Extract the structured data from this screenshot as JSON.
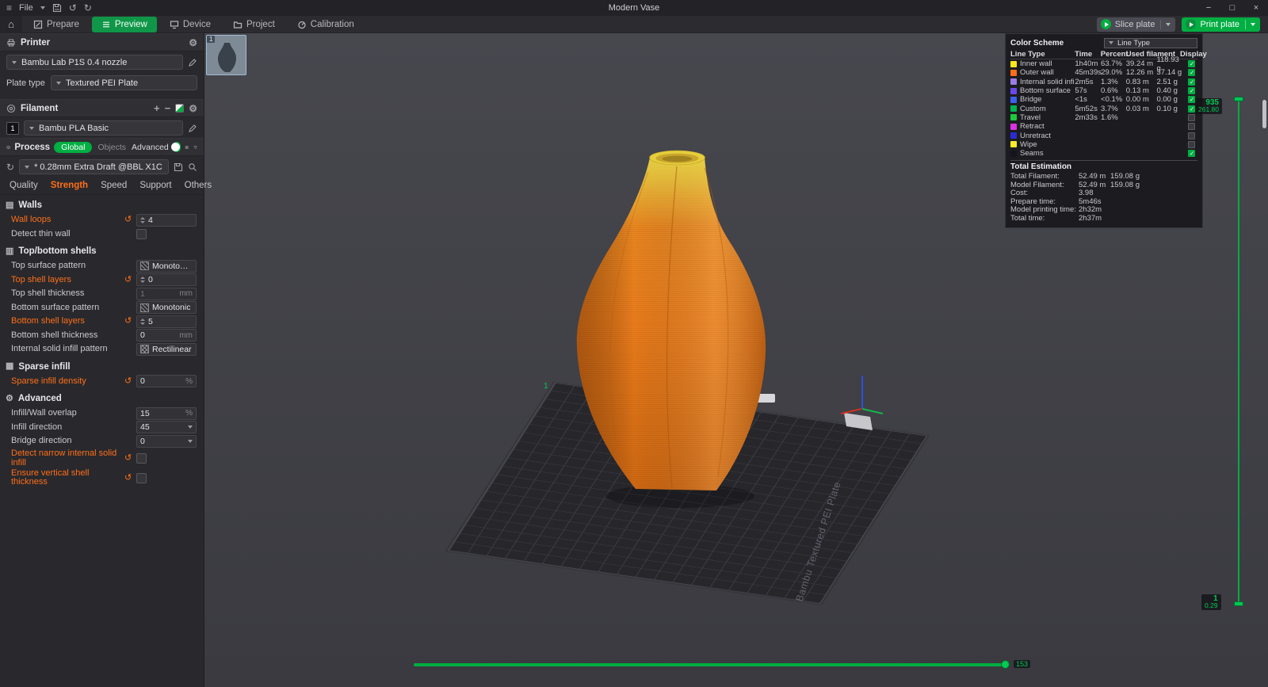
{
  "colors": {
    "accent": "#00AE42",
    "modified": "#FF6E19"
  },
  "icons": {
    "menu": "≡",
    "home": "⌂",
    "gear": "⚙",
    "plus": "+",
    "minus": "−",
    "undo": "↺",
    "redo": "↻",
    "sync": "↻",
    "reset": "↺",
    "minimize": "−",
    "maximize": "□",
    "close": "×"
  },
  "titlebar": {
    "file_label": "File",
    "title": "Modern Vase"
  },
  "tabbar": {
    "tabs": [
      "Prepare",
      "Preview",
      "Device",
      "Project",
      "Calibration"
    ],
    "active_tab": "Preview",
    "slice_label": "Slice plate",
    "print_label": "Print plate"
  },
  "printer": {
    "header": "Printer",
    "preset": "Bambu Lab P1S 0.4 nozzle",
    "plate_type_label": "Plate type",
    "plate_type_value": "Textured PEI Plate"
  },
  "filament": {
    "header": "Filament",
    "slot": "1",
    "preset": "Bambu PLA Basic"
  },
  "process": {
    "header": "Process",
    "scope_global": "Global",
    "scope_objects": "Objects",
    "advanced_label": "Advanced",
    "preset": "* 0.28mm Extra Draft @BBL X1C",
    "tabs": [
      "Quality",
      "Strength",
      "Speed",
      "Support",
      "Others"
    ],
    "active_tab": "Strength"
  },
  "params": {
    "walls_header": "Walls",
    "wall_loops": {
      "label": "Wall loops",
      "value": "4"
    },
    "detect_thin_wall": {
      "label": "Detect thin wall"
    },
    "shells_header": "Top/bottom shells",
    "top_surface_pattern": {
      "label": "Top surface pattern",
      "value": "Monotonic li..."
    },
    "top_shell_layers": {
      "label": "Top shell layers",
      "value": "0"
    },
    "top_shell_thickness": {
      "label": "Top shell thickness",
      "value": "1",
      "unit": "mm"
    },
    "bottom_surface_pattern": {
      "label": "Bottom surface pattern",
      "value": "Monotonic"
    },
    "bottom_shell_layers": {
      "label": "Bottom shell layers",
      "value": "5"
    },
    "bottom_shell_thickness": {
      "label": "Bottom shell thickness",
      "value": "0",
      "unit": "mm"
    },
    "internal_solid_infill_pattern": {
      "label": "Internal solid infill pattern",
      "value": "Rectilinear"
    },
    "sparse_header": "Sparse infill",
    "sparse_infill_density": {
      "label": "Sparse infill density",
      "value": "0",
      "unit": "%"
    },
    "advanced_header": "Advanced",
    "infill_wall_overlap": {
      "label": "Infill/Wall overlap",
      "value": "15",
      "unit": "%"
    },
    "infill_direction": {
      "label": "Infill direction",
      "value": "45"
    },
    "bridge_direction": {
      "label": "Bridge direction",
      "value": "0"
    },
    "detect_narrow_infill": {
      "label": "Detect narrow internal solid infill"
    },
    "ensure_vertical_thickness": {
      "label": "Ensure vertical shell thickness"
    }
  },
  "legend": {
    "title": "Color Scheme",
    "view_type": "Line Type",
    "col_line_type": "Line Type",
    "col_time": "Time",
    "col_percent": "Percent",
    "col_used_filament": "Used filament",
    "col_display": "Display",
    "rows": [
      {
        "name": "Inner wall",
        "color": "#FFE61A",
        "time": "1h40m",
        "percent": "63.7%",
        "len": "39.24 m",
        "weight": "118.93 g",
        "checked": true
      },
      {
        "name": "Outer wall",
        "color": "#FF6E19",
        "time": "45m39s",
        "percent": "29.0%",
        "len": "12.26 m",
        "weight": "37.14 g",
        "checked": true
      },
      {
        "name": "Internal solid infill",
        "color": "#9B7DE8",
        "time": "2m5s",
        "percent": "1.3%",
        "len": "0.83 m",
        "weight": "2.51 g",
        "checked": true
      },
      {
        "name": "Bottom surface",
        "color": "#6B49E8",
        "time": "57s",
        "percent": "0.6%",
        "len": "0.13 m",
        "weight": "0.40 g",
        "checked": true
      },
      {
        "name": "Bridge",
        "color": "#3C60EE",
        "time": "<1s",
        "percent": "<0.1%",
        "len": "0.00 m",
        "weight": "0.00 g",
        "checked": true
      },
      {
        "name": "Custom",
        "color": "#00B450",
        "time": "5m52s",
        "percent": "3.7%",
        "len": "0.03 m",
        "weight": "0.10 g",
        "checked": true
      },
      {
        "name": "Travel",
        "color": "#1EC93C",
        "time": "2m33s",
        "percent": "1.6%",
        "len": "",
        "weight": "",
        "checked": false
      },
      {
        "name": "Retract",
        "color": "#D933DF",
        "time": "",
        "percent": "",
        "len": "",
        "weight": "",
        "checked": false
      },
      {
        "name": "Unretract",
        "color": "#2B2BD5",
        "time": "",
        "percent": "",
        "len": "",
        "weight": "",
        "checked": false
      },
      {
        "name": "Wipe",
        "color": "#FFEC28",
        "time": "",
        "percent": "",
        "len": "",
        "weight": "",
        "checked": false
      },
      {
        "name": "Seams",
        "color": "#14141E",
        "time": "",
        "percent": "",
        "len": "",
        "weight": "",
        "checked": true
      }
    ],
    "total_header": "Total Estimation",
    "totals": [
      {
        "label": "Total Filament:",
        "v1": "52.49 m",
        "v2": "159.08 g"
      },
      {
        "label": "Model Filament:",
        "v1": "52.49 m",
        "v2": "159.08 g"
      },
      {
        "label": "Cost:",
        "v1": "3.98",
        "v2": ""
      },
      {
        "label": "Prepare time:",
        "v1": "5m46s",
        "v2": ""
      },
      {
        "label": "Model printing time:",
        "v1": "2h32m",
        "v2": ""
      },
      {
        "label": "Total time:",
        "v1": "2h37m",
        "v2": ""
      }
    ]
  },
  "viewport": {
    "plate_text": "Bambu Textured PEI Plate",
    "plate_corner_label": "1",
    "thumb_index": "1",
    "layer_slider": {
      "top_layer": "935",
      "top_height": "261.80",
      "bottom_layer": "1",
      "bottom_height": "0.29"
    },
    "move_slider_value": "153"
  }
}
